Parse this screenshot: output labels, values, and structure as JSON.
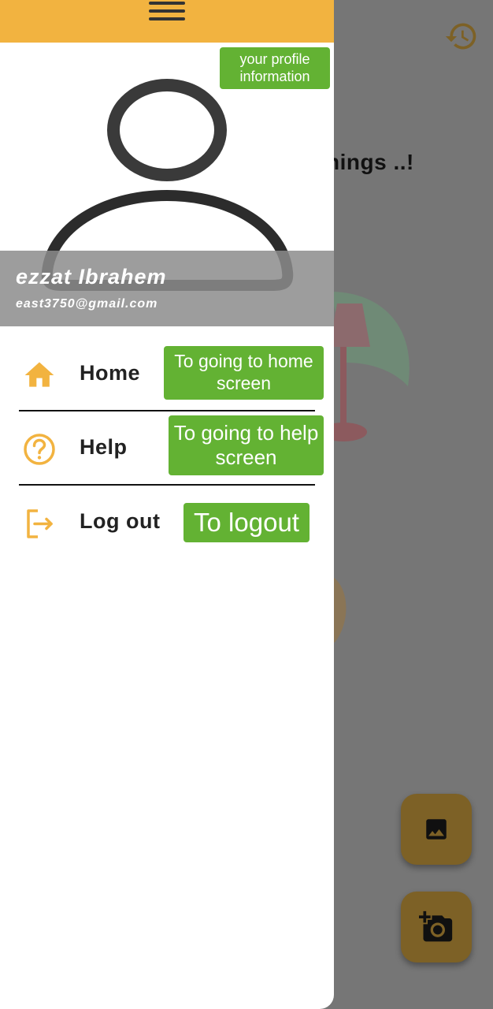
{
  "background": {
    "headline_fragment": "hings ..!",
    "icons": {
      "history": "history-icon",
      "gallery": "image-icon",
      "camera": "add-camera-icon"
    }
  },
  "drawer": {
    "menu_icon": "menu-icon",
    "profile_tip": "your profile information",
    "user": {
      "name": "ezzat Ibrahem",
      "email": "east3750@gmail.com"
    },
    "items": [
      {
        "label": "Home",
        "icon": "home-icon",
        "tip": "To going to home screen"
      },
      {
        "label": "Help",
        "icon": "help-icon",
        "tip": "To going to help screen"
      },
      {
        "label": "Log out",
        "icon": "logout-icon",
        "tip": "To logout"
      }
    ]
  },
  "colors": {
    "accent": "#f2b340",
    "tooltip": "#63b233",
    "scrim": "#767676"
  }
}
